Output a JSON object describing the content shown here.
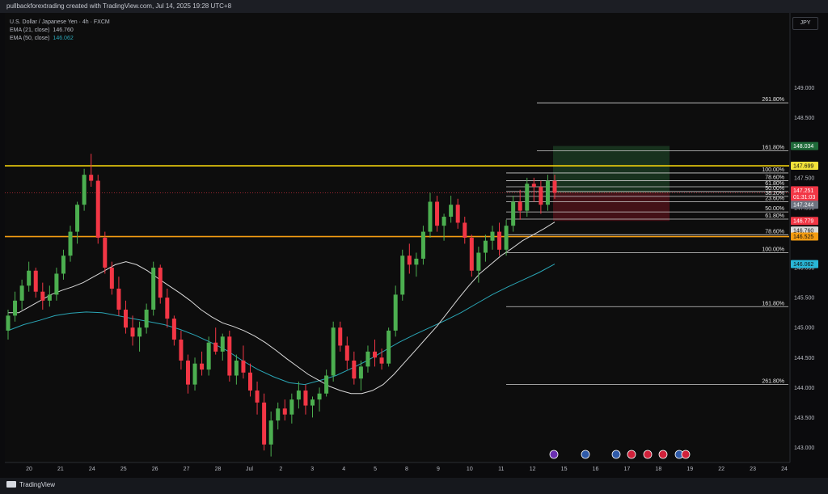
{
  "header": {
    "text": "pullbackforextrading created with TradingView.com, Jul 14, 2025 19:28 UTC+8"
  },
  "legend": {
    "title": "U.S. Dollar / Japanese Yen · 4h · FXCM",
    "ema21_label": "EMA (21, close)",
    "ema21_value": "146.760",
    "ema50_label": "EMA (50, close)",
    "ema50_value": "146.062"
  },
  "currency": "JPY",
  "footer": {
    "brand": "TradingView"
  },
  "colors": {
    "bull": "#4caf50",
    "bear": "#f23645",
    "ema21": "#d9d9d9",
    "ema50": "#2aa5b5",
    "yellow_line": "#f2d10c",
    "orange_line": "#f39c12",
    "target_zone": "#1b3a22",
    "stop_zone": "#4a1218"
  },
  "chart_data": {
    "type": "candlestick",
    "ylim": [
      142.75,
      150.25
    ],
    "y_ticks": [
      "149.000",
      "148.500",
      "148.000",
      "147.500",
      "147.000",
      "146.500",
      "146.000",
      "145.500",
      "145.000",
      "144.500",
      "144.000",
      "143.500",
      "143.000"
    ],
    "x_ticks": [
      "20",
      "21",
      "24",
      "25",
      "26",
      "27",
      "28",
      "Jul",
      "2",
      "3",
      "4",
      "5",
      "8",
      "9",
      "10",
      "11",
      "12",
      "15",
      "16",
      "17",
      "18",
      "19",
      "22",
      "23",
      "24"
    ],
    "ohlc": [
      [
        144.95,
        145.3,
        144.8,
        145.2
      ],
      [
        145.2,
        145.6,
        145.1,
        145.45
      ],
      [
        145.45,
        145.8,
        145.3,
        145.7
      ],
      [
        145.7,
        146.1,
        145.6,
        145.95
      ],
      [
        145.95,
        146.0,
        145.5,
        145.6
      ],
      [
        145.6,
        145.75,
        145.3,
        145.45
      ],
      [
        145.45,
        145.7,
        145.35,
        145.55
      ],
      [
        145.55,
        146.0,
        145.45,
        145.9
      ],
      [
        145.9,
        146.3,
        145.8,
        146.2
      ],
      [
        146.2,
        146.7,
        146.1,
        146.6
      ],
      [
        146.6,
        147.1,
        146.4,
        147.05
      ],
      [
        147.05,
        147.65,
        146.95,
        147.55
      ],
      [
        147.55,
        147.9,
        147.35,
        147.45
      ],
      [
        147.45,
        147.55,
        146.4,
        146.5
      ],
      [
        146.5,
        146.6,
        145.9,
        146.0
      ],
      [
        146.0,
        146.1,
        145.55,
        145.65
      ],
      [
        145.65,
        145.85,
        145.2,
        145.3
      ],
      [
        145.3,
        145.45,
        144.9,
        145.0
      ],
      [
        145.0,
        145.2,
        144.7,
        144.85
      ],
      [
        144.85,
        145.1,
        144.6,
        145.0
      ],
      [
        145.0,
        145.4,
        144.9,
        145.3
      ],
      [
        145.3,
        146.1,
        145.2,
        146.0
      ],
      [
        146.0,
        146.05,
        145.4,
        145.5
      ],
      [
        145.5,
        145.65,
        145.0,
        145.15
      ],
      [
        145.15,
        145.2,
        144.7,
        144.8
      ],
      [
        144.8,
        144.95,
        144.3,
        144.45
      ],
      [
        144.45,
        144.55,
        143.9,
        144.05
      ],
      [
        144.05,
        144.5,
        143.95,
        144.4
      ],
      [
        144.4,
        144.6,
        144.2,
        144.3
      ],
      [
        144.3,
        144.85,
        144.2,
        144.75
      ],
      [
        144.75,
        145.0,
        144.55,
        144.6
      ],
      [
        144.6,
        144.9,
        144.45,
        144.85
      ],
      [
        144.85,
        144.95,
        144.1,
        144.2
      ],
      [
        144.2,
        144.55,
        144.05,
        144.45
      ],
      [
        144.45,
        144.7,
        144.15,
        144.25
      ],
      [
        144.25,
        144.4,
        143.85,
        143.95
      ],
      [
        143.95,
        144.1,
        143.55,
        143.75
      ],
      [
        143.75,
        143.9,
        142.95,
        143.05
      ],
      [
        143.05,
        143.6,
        142.85,
        143.45
      ],
      [
        143.45,
        143.75,
        143.3,
        143.65
      ],
      [
        143.65,
        143.8,
        143.45,
        143.55
      ],
      [
        143.55,
        143.9,
        143.4,
        143.8
      ],
      [
        143.8,
        144.1,
        143.65,
        143.95
      ],
      [
        143.95,
        144.05,
        143.55,
        143.7
      ],
      [
        143.7,
        143.85,
        143.5,
        143.8
      ],
      [
        143.8,
        144.0,
        143.6,
        143.9
      ],
      [
        143.9,
        144.3,
        143.85,
        144.2
      ],
      [
        144.2,
        145.1,
        144.1,
        145.0
      ],
      [
        145.0,
        145.1,
        144.6,
        144.7
      ],
      [
        144.7,
        144.85,
        144.3,
        144.45
      ],
      [
        144.45,
        144.6,
        144.05,
        144.15
      ],
      [
        144.15,
        144.45,
        143.95,
        144.35
      ],
      [
        144.35,
        144.7,
        144.25,
        144.6
      ],
      [
        144.6,
        144.8,
        144.35,
        144.5
      ],
      [
        144.5,
        144.65,
        144.3,
        144.4
      ],
      [
        144.4,
        145.0,
        144.35,
        144.95
      ],
      [
        144.95,
        145.7,
        144.85,
        145.55
      ],
      [
        145.55,
        146.3,
        145.45,
        146.2
      ],
      [
        146.2,
        146.4,
        145.9,
        146.05
      ],
      [
        146.05,
        146.25,
        145.85,
        146.15
      ],
      [
        146.15,
        146.7,
        146.05,
        146.6
      ],
      [
        146.6,
        147.25,
        146.5,
        147.1
      ],
      [
        147.1,
        147.2,
        146.6,
        146.7
      ],
      [
        146.7,
        146.9,
        146.45,
        146.85
      ],
      [
        146.85,
        147.2,
        146.75,
        147.05
      ],
      [
        147.05,
        147.15,
        146.65,
        146.75
      ],
      [
        146.75,
        146.85,
        146.4,
        146.5
      ],
      [
        146.5,
        146.55,
        145.85,
        145.95
      ],
      [
        145.95,
        146.35,
        145.75,
        146.25
      ],
      [
        146.25,
        146.55,
        146.1,
        146.45
      ],
      [
        146.45,
        146.7,
        146.3,
        146.6
      ],
      [
        146.6,
        146.75,
        146.2,
        146.3
      ],
      [
        146.3,
        146.8,
        146.2,
        146.7
      ],
      [
        146.7,
        147.2,
        146.6,
        147.1
      ],
      [
        147.1,
        147.3,
        146.8,
        146.95
      ],
      [
        146.95,
        147.5,
        146.85,
        147.4
      ],
      [
        147.4,
        147.5,
        147.1,
        147.35
      ],
      [
        147.35,
        147.45,
        146.9,
        147.05
      ],
      [
        147.05,
        147.55,
        146.95,
        147.45
      ],
      [
        147.45,
        147.55,
        147.15,
        147.25
      ]
    ],
    "ema21": [
      145.25,
      145.25,
      145.35,
      145.45,
      145.55,
      145.62,
      145.68,
      145.75,
      145.85,
      145.95,
      146.05,
      146.1,
      146.05,
      145.95,
      145.82,
      145.7,
      145.58,
      145.45,
      145.3,
      145.18,
      145.08,
      145.02,
      144.95,
      144.86,
      144.75,
      144.62,
      144.48,
      144.35,
      144.22,
      144.12,
      144.02,
      143.95,
      143.9,
      143.9,
      143.95,
      144.05,
      144.22,
      144.42,
      144.62,
      144.82,
      145.02,
      145.25,
      145.48,
      145.7,
      145.9,
      146.05,
      146.2,
      146.32,
      146.45,
      146.55,
      146.65,
      146.76
    ],
    "ema50": [
      144.95,
      145.05,
      145.12,
      145.2,
      145.24,
      145.26,
      145.25,
      145.2,
      145.15,
      145.1,
      145.05,
      144.97,
      144.87,
      144.75,
      144.62,
      144.45,
      144.3,
      144.18,
      144.08,
      144.05,
      144.12,
      144.2,
      144.32,
      144.45,
      144.6,
      144.75,
      144.88,
      145.0,
      145.12,
      145.25,
      145.4,
      145.55,
      145.68,
      145.8,
      145.92,
      146.06
    ],
    "fib_upper": [
      {
        "label": "261.80%",
        "price": 148.75
      },
      {
        "label": "161.80%",
        "price": 147.95
      },
      {
        "label": "100.00%",
        "price": 147.58
      },
      {
        "label": "78.60%",
        "price": 147.45
      },
      {
        "label": "61.80%",
        "price": 147.35
      },
      {
        "label": "50.00%",
        "price": 147.27
      },
      {
        "label": "38.20%",
        "price": 147.19
      },
      {
        "label": "23.60%",
        "price": 147.1
      },
      {
        "label": "50.00%",
        "price": 146.93
      }
    ],
    "fib_lower": [
      {
        "label": "61.80%",
        "price": 146.81
      },
      {
        "label": "78.60%",
        "price": 146.55
      },
      {
        "label": "100.00%",
        "price": 146.25
      },
      {
        "label": "161.80%",
        "price": 145.35
      },
      {
        "label": "261.80%",
        "price": 144.05
      }
    ],
    "horizontal_lines": [
      {
        "name": "resistance",
        "price": 147.7
      },
      {
        "name": "support",
        "price": 146.52
      }
    ],
    "price_tags": [
      {
        "value": "148.034",
        "price": 148.03,
        "bg": "#1f6b3a",
        "fg": "#ffffff"
      },
      {
        "value": "147.699",
        "price": 147.7,
        "bg": "#f2e23a",
        "fg": "#111111"
      },
      {
        "value": "147.251",
        "price": 147.29,
        "bg": "#f23645",
        "fg": "#ffffff"
      },
      {
        "value": "01:31:03",
        "price": 147.18,
        "bg": "#f23645",
        "fg": "#ffffff"
      },
      {
        "value": "147.244",
        "price": 147.05,
        "bg": "#6d7380",
        "fg": "#ffffff"
      },
      {
        "value": "146.779",
        "price": 146.78,
        "bg": "#f23645",
        "fg": "#ffffff"
      },
      {
        "value": "146.760",
        "price": 146.62,
        "bg": "#d9d9d9",
        "fg": "#111111"
      },
      {
        "value": "146.525",
        "price": 146.52,
        "bg": "#f39c12",
        "fg": "#111111"
      },
      {
        "value": "146.062",
        "price": 146.06,
        "bg": "#29b6d6",
        "fg": "#111111"
      }
    ],
    "position": {
      "target_top": 148.03,
      "entry": 147.25,
      "stop_bottom": 146.78
    }
  }
}
